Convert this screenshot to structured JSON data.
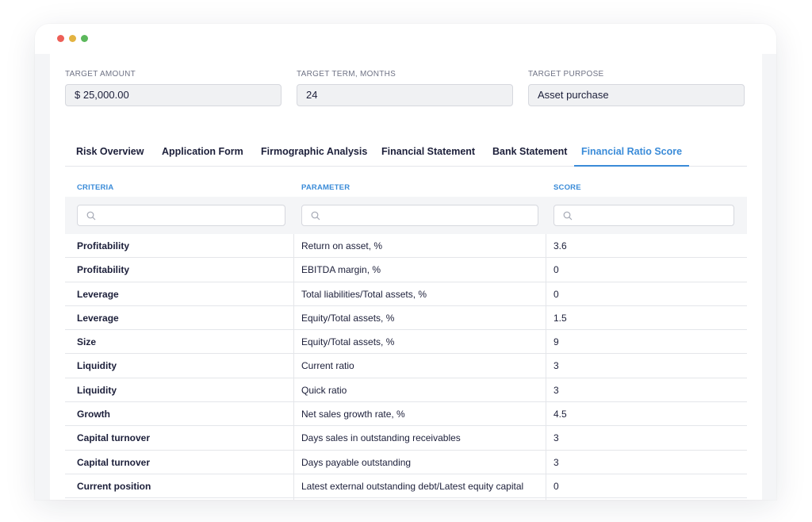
{
  "form": {
    "target_amount": {
      "label": "TARGET AMOUNT",
      "value": "$ 25,000.00"
    },
    "target_term": {
      "label": "TARGET TERM, MONTHS",
      "value": "24"
    },
    "target_purpose": {
      "label": "TARGET PURPOSE",
      "value": "Asset purchase"
    }
  },
  "tabs": [
    {
      "label": "Risk Overview"
    },
    {
      "label": "Application Form"
    },
    {
      "label": "Firmographic Analysis"
    },
    {
      "label": "Financial Statement"
    },
    {
      "label": "Bank Statement"
    },
    {
      "label": "Financial Ratio Score",
      "active": true
    }
  ],
  "table": {
    "columns": [
      "CRITERIA",
      "PARAMETER",
      "SCORE"
    ],
    "rows": [
      {
        "criteria": "Profitability",
        "parameter": "Return on asset, %",
        "score": "3.6"
      },
      {
        "criteria": "Profitability",
        "parameter": "EBITDA margin, %",
        "score": "0"
      },
      {
        "criteria": "Leverage",
        "parameter": "Total liabilities/Total assets, %",
        "score": "0"
      },
      {
        "criteria": "Leverage",
        "parameter": "Equity/Total assets, %",
        "score": "1.5"
      },
      {
        "criteria": "Size",
        "parameter": "Equity/Total assets, %",
        "score": "9"
      },
      {
        "criteria": "Liquidity",
        "parameter": "Current ratio",
        "score": "3"
      },
      {
        "criteria": "Liquidity",
        "parameter": "Quick ratio",
        "score": "3"
      },
      {
        "criteria": "Growth",
        "parameter": "Net sales growth rate, %",
        "score": "4.5"
      },
      {
        "criteria": "Capital turnover",
        "parameter": "Days sales in outstanding receivables",
        "score": "3"
      },
      {
        "criteria": "Capital turnover",
        "parameter": "Days payable outstanding",
        "score": "3"
      },
      {
        "criteria": "Current position",
        "parameter": "Latest external outstanding debt/Latest equity capital",
        "score": "0"
      }
    ]
  },
  "colors": {
    "accent": "#3a8bd8",
    "text": "#1c1f3a",
    "muted": "#6f7385"
  },
  "icons": {
    "search": "search-icon"
  }
}
